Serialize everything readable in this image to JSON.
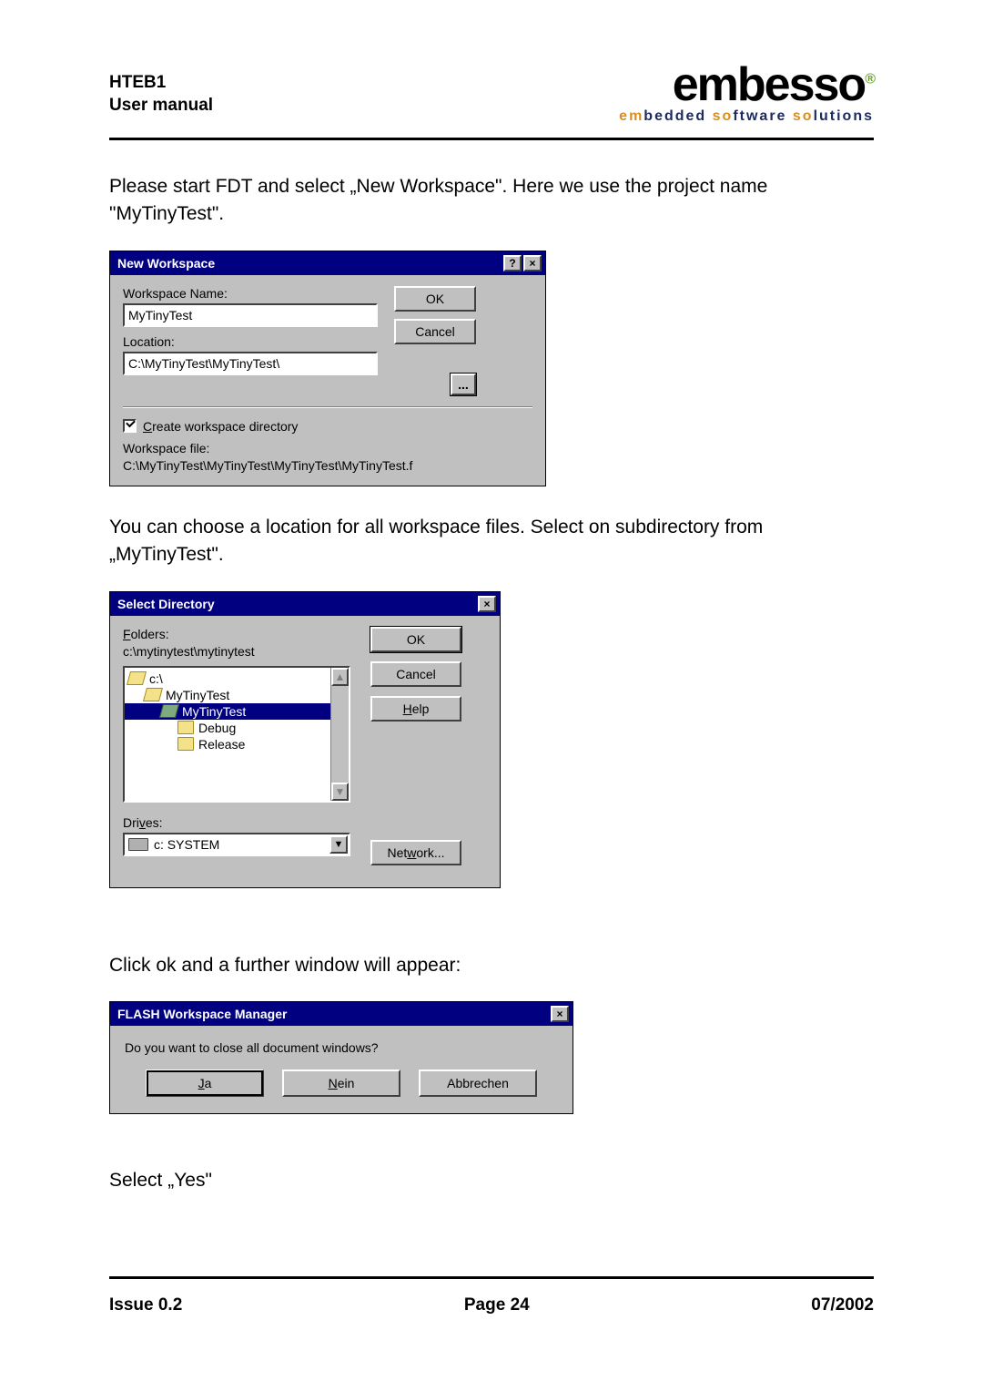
{
  "header": {
    "line1": "HTEB1",
    "line2": "User manual"
  },
  "logo": {
    "top": "embesso",
    "sub_word1_orange": "em",
    "sub_word1_rest": "bedded ",
    "sub_word2_orange": "so",
    "sub_word2_rest": "ftware ",
    "sub_word3_orange": "so",
    "sub_word3_rest": "lutions"
  },
  "para1": "Please start FDT and select „New Workspace\". Here we use the project name \"MyTinyTest\".",
  "nw": {
    "title": "New Workspace",
    "name_label": "Workspace Name:",
    "name_value": "MyTinyTest",
    "location_label": "Location:",
    "location_value": "C:\\MyTinyTest\\MyTinyTest\\",
    "ok": "OK",
    "cancel": "Cancel",
    "browse": "...",
    "chk_label": "Create workspace directory",
    "file_label": "Workspace file:",
    "file_value": "C:\\MyTinyTest\\MyTinyTest\\MyTinyTest\\MyTinyTest.f"
  },
  "para2": "You can choose a location for all workspace files. Select on subdirectory from „MyTinyTest\".",
  "sd": {
    "title": "Select Directory",
    "folders_label": "Folders:",
    "path": "c:\\mytinytest\\mytinytest",
    "tree": [
      "c:\\",
      "MyTinyTest",
      "MyTinyTest",
      "Debug",
      "Release"
    ],
    "ok": "OK",
    "cancel": "Cancel",
    "help": "Help",
    "drives_label": "Drives:",
    "drive_value": "c: SYSTEM",
    "network": "Network..."
  },
  "para3": "Click ok and a further window will appear:",
  "fwm": {
    "title": "FLASH Workspace Manager",
    "question": "Do you want to close all document windows?",
    "ja": "Ja",
    "nein": "Nein",
    "abbrechen": "Abbrechen"
  },
  "para4": "Select „Yes\"",
  "footer": {
    "left": "Issue 0.2",
    "center": "Page 24",
    "right": "07/2002"
  }
}
